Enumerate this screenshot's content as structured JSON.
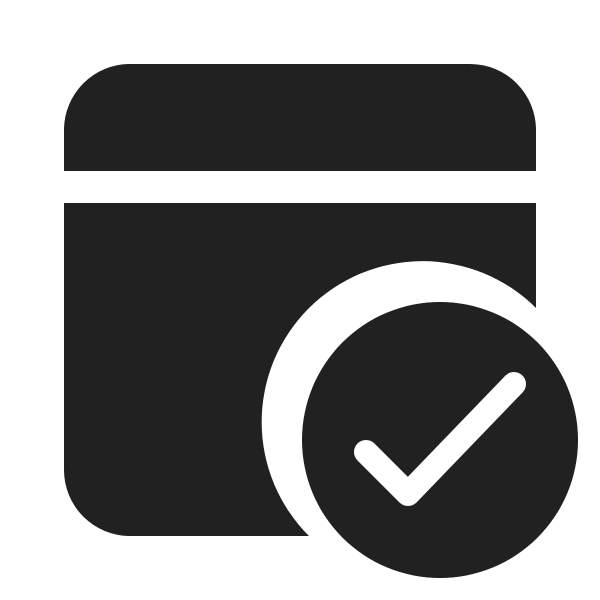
{
  "icon": {
    "name": "calendar-checkmark-icon",
    "parts": [
      "calendar-header-icon",
      "calendar-body-icon",
      "checkmark-badge-icon"
    ]
  },
  "colors": {
    "background": "#ffffff",
    "glyph": "#212121",
    "check_stroke": "#ffffff"
  }
}
